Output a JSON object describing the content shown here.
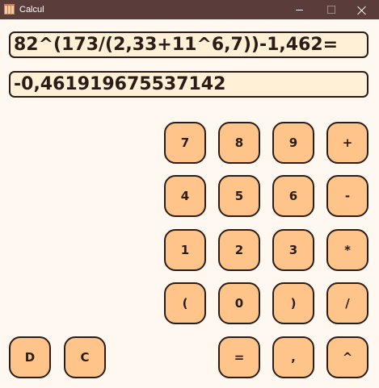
{
  "window": {
    "title": "Calcul",
    "app_icon": "calculator-grid-icon",
    "controls": {
      "minimize": "minimize-icon",
      "maximize": "maximize-icon",
      "close": "close-icon"
    }
  },
  "display": {
    "expression": "82^(173/(2,33+11^6,7))-1,462=",
    "result": "-0,461919675537142"
  },
  "keys": {
    "k7": "7",
    "k8": "8",
    "k9": "9",
    "plus": "+",
    "k4": "4",
    "k5": "5",
    "k6": "6",
    "minus": "-",
    "k1": "1",
    "k2": "2",
    "k3": "3",
    "multiply": "*",
    "lparen": "(",
    "k0": "0",
    "rparen": ")",
    "divide": "/",
    "delete": "D",
    "clear": "C",
    "equals": "=",
    "comma": ",",
    "power": "^"
  },
  "colors": {
    "titlebar": "#5a3d3a",
    "background": "#fff8f0",
    "field_bg": "#fff0d6",
    "key_bg": "#ffc48a",
    "border": "#2b1c18"
  }
}
